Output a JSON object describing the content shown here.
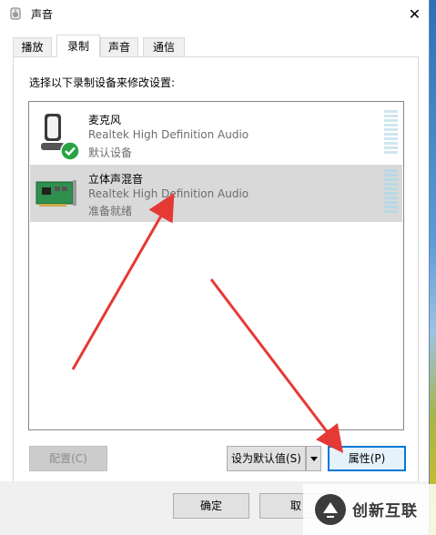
{
  "window": {
    "title": "声音",
    "close_glyph": "✕"
  },
  "tabs": [
    {
      "label": "播放",
      "active": false
    },
    {
      "label": "录制",
      "active": true
    },
    {
      "label": "声音",
      "active": false
    },
    {
      "label": "通信",
      "active": false
    }
  ],
  "instruction": "选择以下录制设备来修改设置:",
  "devices": [
    {
      "name": "麦克风",
      "driver": "Realtek High Definition Audio",
      "status": "默认设备",
      "icon": "microphone-icon",
      "default_badge": "check-badge-icon",
      "selected": false
    },
    {
      "name": "立体声混音",
      "driver": "Realtek High Definition Audio",
      "status": "准备就绪",
      "icon": "sound-card-icon",
      "selected": true
    }
  ],
  "buttons": {
    "configure": "配置(C)",
    "set_default": "设为默认值(S)",
    "properties": "属性(P)",
    "ok": "确定",
    "cancel": "取"
  },
  "watermark": {
    "text": "创新互联",
    "icon": "brand-logo-icon"
  },
  "colors": {
    "arrow": "#e53935",
    "selection": "#d9d9d9",
    "focus": "#0078d7"
  }
}
